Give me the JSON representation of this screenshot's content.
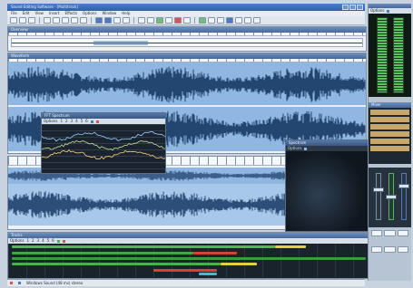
{
  "window": {
    "title": "Sound Editing Software - [Multitrack]"
  },
  "menu": {
    "items": [
      "File",
      "Edit",
      "View",
      "Insert",
      "Effects",
      "Options",
      "Window",
      "Help"
    ]
  },
  "overview_panel": {
    "title": "Overview"
  },
  "wave_panel": {
    "title": "Waveform"
  },
  "spectrum_window": {
    "title": "FFT Spectrum",
    "options_label": "Options",
    "tab_numbers": [
      "1",
      "2",
      "3",
      "4",
      "5",
      "6"
    ]
  },
  "spectrogram_window": {
    "title": "Spectrum",
    "options_label": "Options"
  },
  "track_panel": {
    "title": "Tracks",
    "options_label": "Options",
    "tab_numbers": [
      "1",
      "2",
      "3",
      "4",
      "5",
      "6"
    ]
  },
  "right_panel": {
    "options_label": "Options",
    "mixer_title": "Mixer"
  },
  "status": {
    "text": "Windows Sound (48 ms) stereo"
  },
  "colors": {
    "accent": "#4a78c2",
    "wave": "#8fb7e2",
    "meter": "#58c45f",
    "dark": "#1f2a37"
  }
}
